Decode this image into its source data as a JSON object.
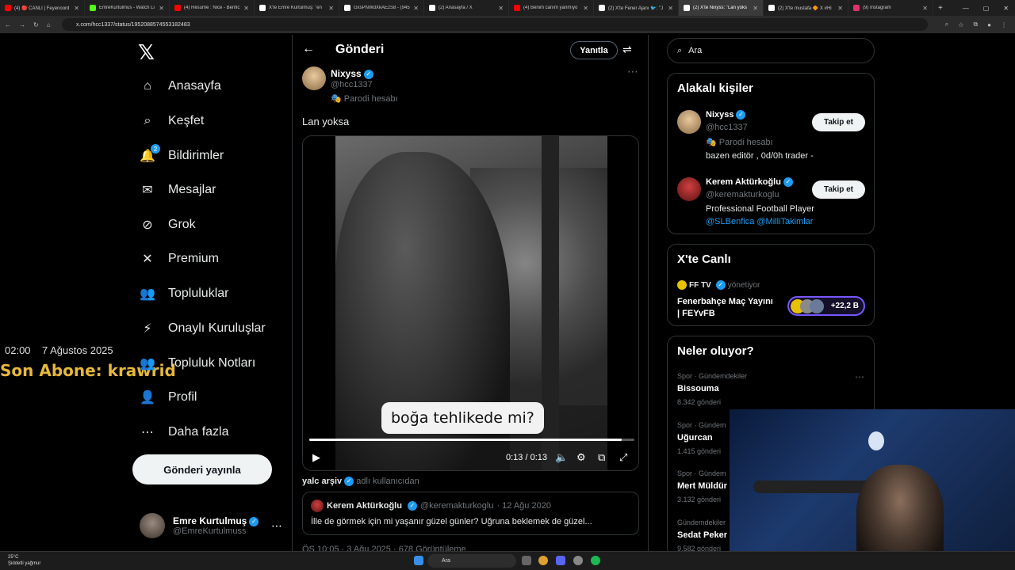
{
  "browser": {
    "tabs": [
      {
        "title": "(4) 🔴 CANLI | Feyenoord",
        "active": false,
        "color": "#ff0000"
      },
      {
        "title": "EmreKurtulmus - Watch Li",
        "active": false,
        "color": "#53fc18"
      },
      {
        "title": "(4) Résumé : Nice - Benfic",
        "active": false,
        "color": "#ff0000"
      },
      {
        "title": "X'te Emre Kurtulmuş: \"en",
        "active": false,
        "color": "#ffffff"
      },
      {
        "title": "GxsPNWdXkAEzS8 - (945",
        "active": false,
        "color": "#ffffff"
      },
      {
        "title": "(2) Anasayfa / X",
        "active": false,
        "color": "#ffffff"
      },
      {
        "title": "(4) Benim canım yanmıyo",
        "active": false,
        "color": "#ff0000"
      },
      {
        "title": "(2) X'te Fener Ajanı 🐦: \"J",
        "active": false,
        "color": "#ffffff"
      },
      {
        "title": "(2) X'te Nixyss: \"Lan yoks",
        "active": true,
        "color": "#ffffff"
      },
      {
        "title": "(2) X'te mustafa 🔶 X #Hi",
        "active": false,
        "color": "#ffffff"
      },
      {
        "title": "(9) Instagram",
        "active": false,
        "color": "#e1306c"
      }
    ],
    "url": "x.com/hcc1337/status/1952088574553182483"
  },
  "sidebar": {
    "logo": "𝕏",
    "items": [
      {
        "label": "Anasayfa",
        "icon": "home-icon",
        "glyph": "⌂"
      },
      {
        "label": "Keşfet",
        "icon": "search-icon",
        "glyph": "⌕"
      },
      {
        "label": "Bildirimler",
        "icon": "bell-icon",
        "glyph": "🔔",
        "badge": "2"
      },
      {
        "label": "Mesajlar",
        "icon": "mail-icon",
        "glyph": "✉"
      },
      {
        "label": "Grok",
        "icon": "grok-icon",
        "glyph": "⊘"
      },
      {
        "label": "Premium",
        "icon": "x-premium-icon",
        "glyph": "✕"
      },
      {
        "label": "Topluluklar",
        "icon": "communities-icon",
        "glyph": "👥"
      },
      {
        "label": "Onaylı Kuruluşlar",
        "icon": "lightning-icon",
        "glyph": "⚡"
      },
      {
        "label": "Topluluk Notları",
        "icon": "notes-icon",
        "glyph": "👥"
      },
      {
        "label": "Profil",
        "icon": "profile-icon",
        "glyph": "👤"
      },
      {
        "label": "Daha fazla",
        "icon": "more-circle-icon",
        "glyph": "⋯"
      }
    ],
    "post_button": "Gönderi yayınla",
    "account": {
      "name": "Emre Kurtulmuş",
      "handle": "@EmreKurtulmuss"
    }
  },
  "overlay": {
    "time": "02:00",
    "date": "7 Ağustos 2025",
    "subscriber": "Son Abone: krawrid"
  },
  "post_page": {
    "header_title": "Gönderi",
    "reply_label": "Yanıtla",
    "author_name": "Nixyss",
    "author_handle": "@hcc1337",
    "author_label": "🎭 Parodi hesabı",
    "text": "Lan yoksa",
    "video": {
      "caption": "boğa tehlikede mi?",
      "time": "0:13 / 0:13",
      "progress": 0.96
    },
    "source_user": "yalc arşiv",
    "source_suffix": "adlı kullanıcıdan",
    "quote": {
      "name": "Kerem Aktürkoğlu",
      "handle": "@keremakturkoglu",
      "date": "· 12 Ağu 2020",
      "text": "İlle de görmek için mi yaşanır güzel günler? Uğruna beklemek de güzel..."
    },
    "meta": "ÖS 10:05 · 3 Ağu 2025 · 678 Görüntüleme"
  },
  "right": {
    "search_placeholder": "Ara",
    "relevant": {
      "title": "Alakalı kişiler",
      "people": [
        {
          "name": "Nixyss",
          "handle": "@hcc1337",
          "line1": "🎭 Parodi hesabı",
          "line2": "bazen editör , 0d/0h trader -",
          "button": "Takip et"
        },
        {
          "name": "Kerem Aktürkoğlu",
          "handle": "@keremakturkoglu",
          "line1": "Professional Football Player",
          "line2": "@SLBenfica @MilliTakimlar",
          "button": "Takip et"
        }
      ]
    },
    "live": {
      "title": "X'te Canlı",
      "host": "FF TV",
      "host_suffix": "yönetiyor",
      "event_line1": "Fenerbahçe Maç Yayını",
      "event_line2": "| FEYvFB",
      "listeners": "+22,2 B"
    },
    "trends": {
      "title": "Neler oluyor?",
      "items": [
        {
          "category": "Spor · Gündemdekiler",
          "name": "Bissouma",
          "count": "8.342 gönderi"
        },
        {
          "category": "Spor · Gündem",
          "name": "Uğurcan",
          "count": "1.415 gönderi"
        },
        {
          "category": "Spor · Gündem",
          "name": "Mert Müldür",
          "count": "3.132 gönderi"
        },
        {
          "category": "Gündemdekiler",
          "name": "Sedat Peker",
          "count": "9.582 gönderi"
        }
      ]
    }
  },
  "taskbar": {
    "temp": "25°C",
    "weather": "Şiddetli yağmur",
    "search": "Ara"
  },
  "colors": {
    "accent": "#1d9bf0",
    "background": "#000000",
    "border": "#2f3336",
    "overlay_text": "#e6b83b"
  }
}
